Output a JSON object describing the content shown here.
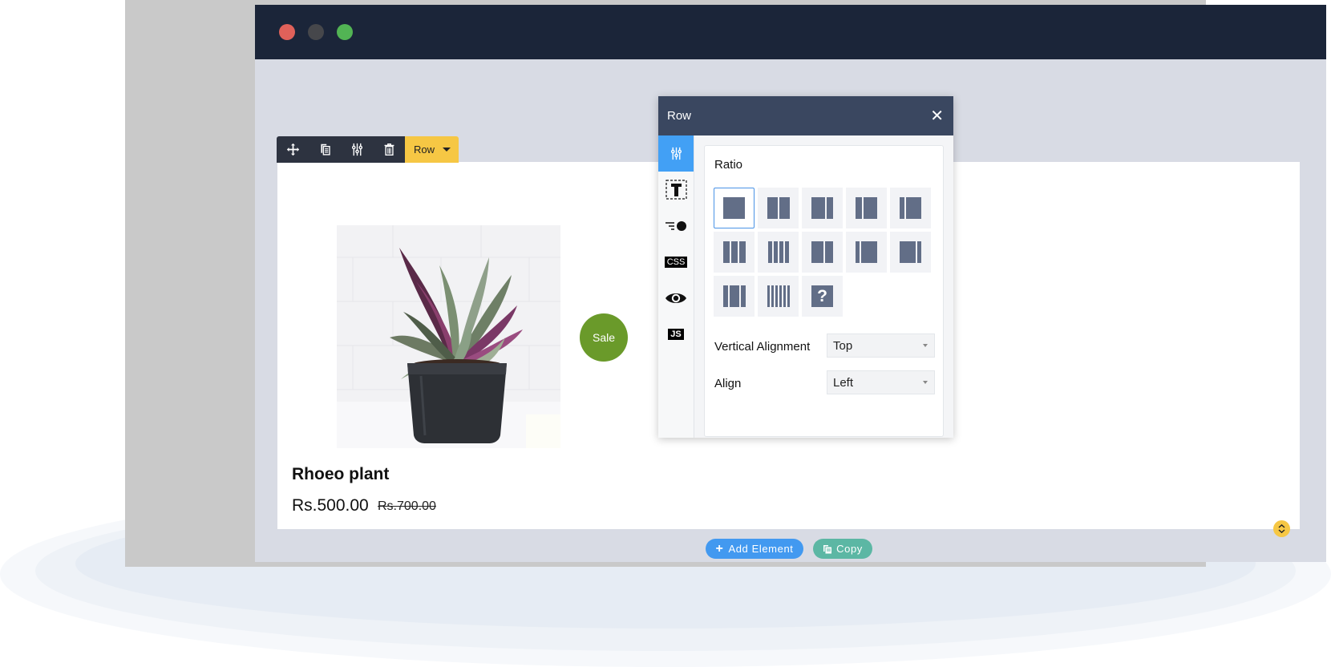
{
  "window": {
    "controls": [
      "close",
      "minimize",
      "maximize"
    ],
    "colors": {
      "close": "#e0615a",
      "minimize": "#46474b",
      "maximize": "#52b454",
      "titlebar": "#1b2539"
    }
  },
  "row_toolbar": {
    "icons": [
      "move-icon",
      "duplicate-icon",
      "settings-sliders-icon",
      "trash-icon"
    ],
    "row_label": "Row",
    "accent": "#f6c744"
  },
  "product": {
    "name": "Rhoeo plant",
    "price": "Rs.500.00",
    "old_price": "Rs.700.00",
    "sale_badge": "Sale",
    "sale_color": "#6a9a2a"
  },
  "panel": {
    "title": "Row",
    "close_label": "✕",
    "sidebar": [
      {
        "name": "settings",
        "active": true
      },
      {
        "name": "typography"
      },
      {
        "name": "animation"
      },
      {
        "name": "css",
        "label": "CSS"
      },
      {
        "name": "visibility"
      },
      {
        "name": "js",
        "label": "JS"
      }
    ],
    "ratio_label": "Ratio",
    "ratios": [
      {
        "id": "1",
        "cols": [
          1
        ],
        "selected": true
      },
      {
        "id": "1/2+1/2",
        "cols": [
          1,
          1
        ]
      },
      {
        "id": "2/3+1/3",
        "cols": [
          2,
          1
        ]
      },
      {
        "id": "1/3+2/3",
        "cols": [
          1,
          2
        ]
      },
      {
        "id": "1/4+3/4",
        "cols": [
          1,
          3
        ]
      },
      {
        "id": "1/3x3",
        "cols": [
          1,
          1,
          1
        ]
      },
      {
        "id": "1/4x4",
        "cols": [
          1,
          1,
          1,
          1
        ]
      },
      {
        "id": "3/4+1/4",
        "cols": [
          3,
          2
        ]
      },
      {
        "id": "1/6+5/6",
        "cols": [
          1,
          4
        ]
      },
      {
        "id": "5/6+1/6",
        "cols": [
          4,
          1
        ]
      },
      {
        "id": "1/4+1/2+1/4",
        "cols": [
          1,
          2,
          1
        ]
      },
      {
        "id": "1/6x6",
        "cols": [
          1,
          1,
          1,
          1,
          1,
          1
        ]
      },
      {
        "id": "custom",
        "custom": true,
        "label": "?"
      }
    ],
    "vertical_alignment": {
      "label": "Vertical Alignment",
      "value": "Top"
    },
    "align": {
      "label": "Align",
      "value": "Left"
    }
  },
  "actions": {
    "add_element": "Add Element",
    "add_icon": "+",
    "copy": "Copy",
    "add_color": "#4299f0",
    "copy_color": "#5cb7a4"
  }
}
